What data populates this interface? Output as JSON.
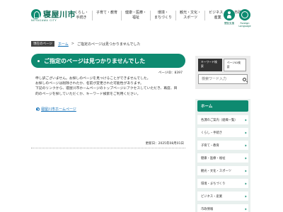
{
  "header": {
    "logo_text": "寝屋川市",
    "logo_sub": "NEYAGAWA CITY",
    "nav": [
      "くらし・\n手続き",
      "子育て・教育",
      "健康・医療・\n福祉",
      "環境・\nまちづくり",
      "観光・文化・\nスポーツ",
      "ビジネス・\n産業",
      "市政情報"
    ],
    "icons": [
      {
        "icon": "accessibility-person-icon",
        "label": "閲覧支援"
      },
      {
        "icon": "globe-icon",
        "label": "Foreign\nLanguage"
      }
    ]
  },
  "breadcrumb": {
    "badge": "現在のページ",
    "home": "ホーム",
    "sep": ">",
    "current": "ご指定のページは見つかりませんでした"
  },
  "main": {
    "title": "ご指定のページは見つかりませんでした",
    "page_id": "ページID：8397",
    "paragraphs": [
      "申し訳ございません。お探しのページを見つけることができませんでした。",
      "お探しのページは削除されたか、名前が変更された可能性があります。",
      "下記のリンクから、寝屋川市ホームページのトップページにアクセスしていただき、再度、目",
      "的のページを探していただくか、キーワード検索をご利用ください。"
    ],
    "back_link": "寝屋川市ホームページ",
    "updated": "更新日：2025年08月01日"
  },
  "sidebar": {
    "tabs": [
      "キーワード検索",
      "ページID検索"
    ],
    "search_placeholder": "検索ワード入力",
    "nav_head": "ホーム",
    "nav_items": [
      "各課のご案内（組織一覧）",
      "くらし・手続き",
      "子育て・教育",
      "健康・医療・福祉",
      "観光・文化・スポーツ",
      "環境・まちづくり",
      "ビジネス・産業",
      "市政情報"
    ]
  },
  "colors": {
    "brand": "#0e8a70",
    "link": "#0a6bb5"
  }
}
